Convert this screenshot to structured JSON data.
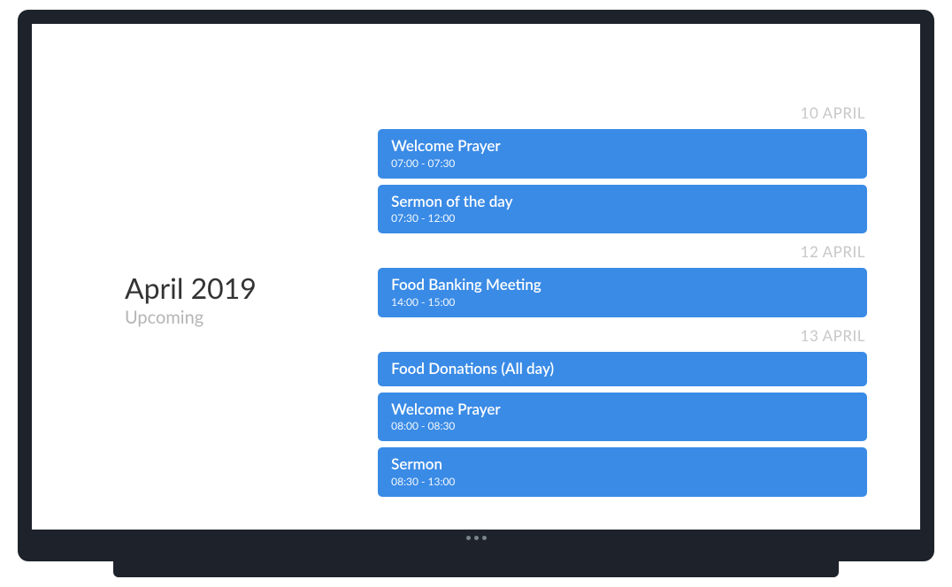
{
  "colors": {
    "event_bg": "#3a8be6",
    "muted": "#c8c8c8",
    "text": "#333333"
  },
  "sidebar": {
    "title": "April 2019",
    "subtitle": "Upcoming"
  },
  "days": [
    {
      "label": "10 APRIL",
      "events": [
        {
          "title": "Welcome Prayer",
          "time": "07:00 - 07:30"
        },
        {
          "title": "Sermon of the day",
          "time": "07:30 - 12:00"
        }
      ]
    },
    {
      "label": "12 APRIL",
      "events": [
        {
          "title": "Food Banking Meeting",
          "time": "14:00 - 15:00"
        }
      ]
    },
    {
      "label": "13 APRIL",
      "events": [
        {
          "title": "Food Donations (All day)",
          "time": ""
        },
        {
          "title": "Welcome Prayer",
          "time": "08:00 - 08:30"
        },
        {
          "title": "Sermon",
          "time": "08:30 - 13:00"
        }
      ]
    }
  ]
}
